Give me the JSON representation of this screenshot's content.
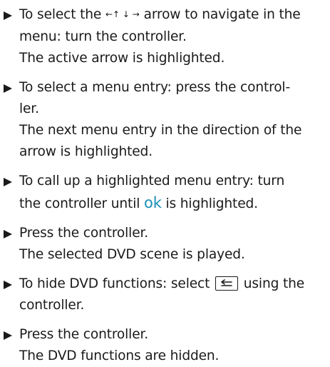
{
  "steps": [
    {
      "l1_pre": "To select the ",
      "arrows": "←↑ ↓ →",
      "l1_post": " arrow to navigate in the",
      "l2": "menu: turn the controller.",
      "l3": "The active arrow is highlighted."
    },
    {
      "l1": "To select a menu entry: press the control-",
      "l2": "ler.",
      "l3": "The next menu entry in the direction of the",
      "l4": "arrow is highlighted."
    },
    {
      "l1": "To call up a highlighted menu entry: turn",
      "l2_pre": "the controller until ",
      "ok": "ok",
      "l2_post": " is highlighted."
    },
    {
      "l1": "Press the controller.",
      "l2": "The selected DVD scene is played."
    },
    {
      "l1_pre": "To hide DVD functions: select ",
      "icon": "back-icon",
      "l1_post": " using the",
      "l2": "controller."
    },
    {
      "l1": "Press the controller.",
      "l2": "The DVD functions are hidden."
    }
  ],
  "colors": {
    "text": "#1a1a1a",
    "ok_highlight": "#1a8fb8"
  }
}
